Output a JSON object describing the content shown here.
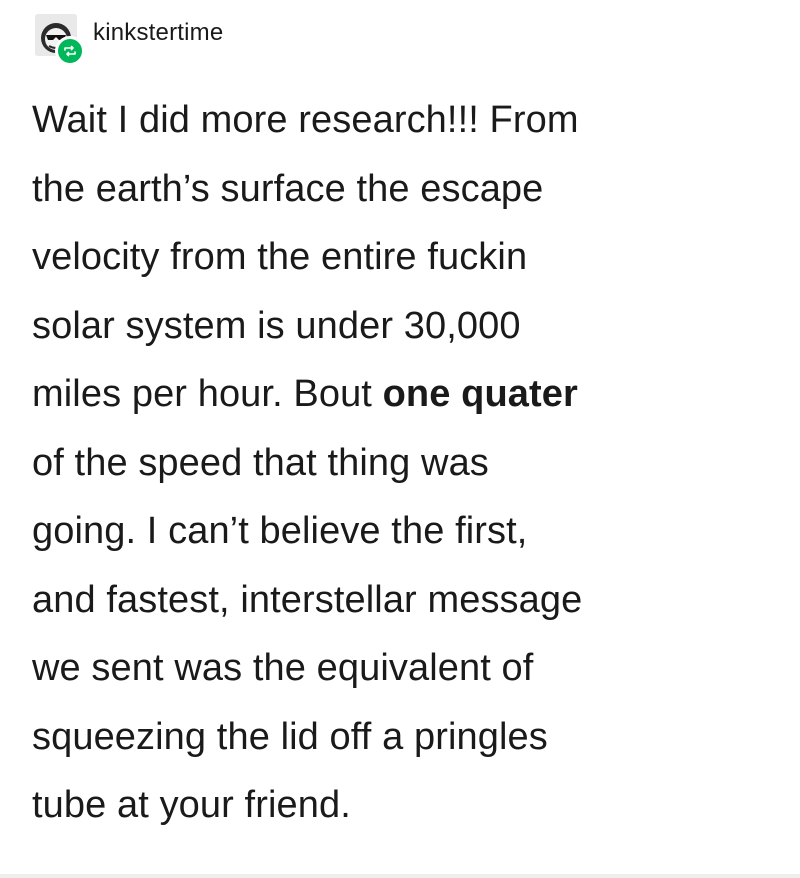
{
  "post": {
    "username": "kinkstertime",
    "avatar_icon": "sunglasses-face-icon",
    "reblog_icon": "reblog-icon",
    "reblog_color": "#00b75a",
    "body_lines": [
      "Wait I did more research!!! From",
      "the earth’s surface the escape",
      "velocity from the entire fuckin",
      "solar system is under 30,000"
    ],
    "line5_plain": "miles per hour. Bout ",
    "line5_bold": "one quater",
    "body_lines_after": [
      "of the speed that thing was",
      "going. I can’t believe the first,",
      "and fastest, interstellar message",
      "we sent was the equivalent of",
      "squeezing the lid off a pringles",
      "tube at your friend."
    ]
  }
}
